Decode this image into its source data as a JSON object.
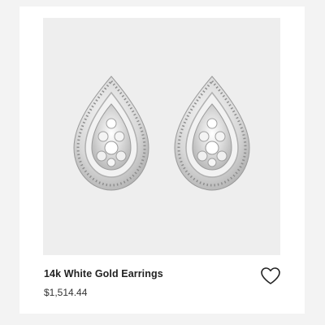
{
  "product": {
    "title": "14k White Gold Earrings",
    "price": "$1,514.44",
    "image_icon": "pear-halo-diamond-stud-earrings",
    "favorite_icon": "heart-outline-icon"
  },
  "colors": {
    "page_background": "#f3f3f3",
    "card_background": "#ffffff",
    "image_background": "#eeeeee",
    "metal": "#d9d9d9",
    "text": "#222222"
  }
}
